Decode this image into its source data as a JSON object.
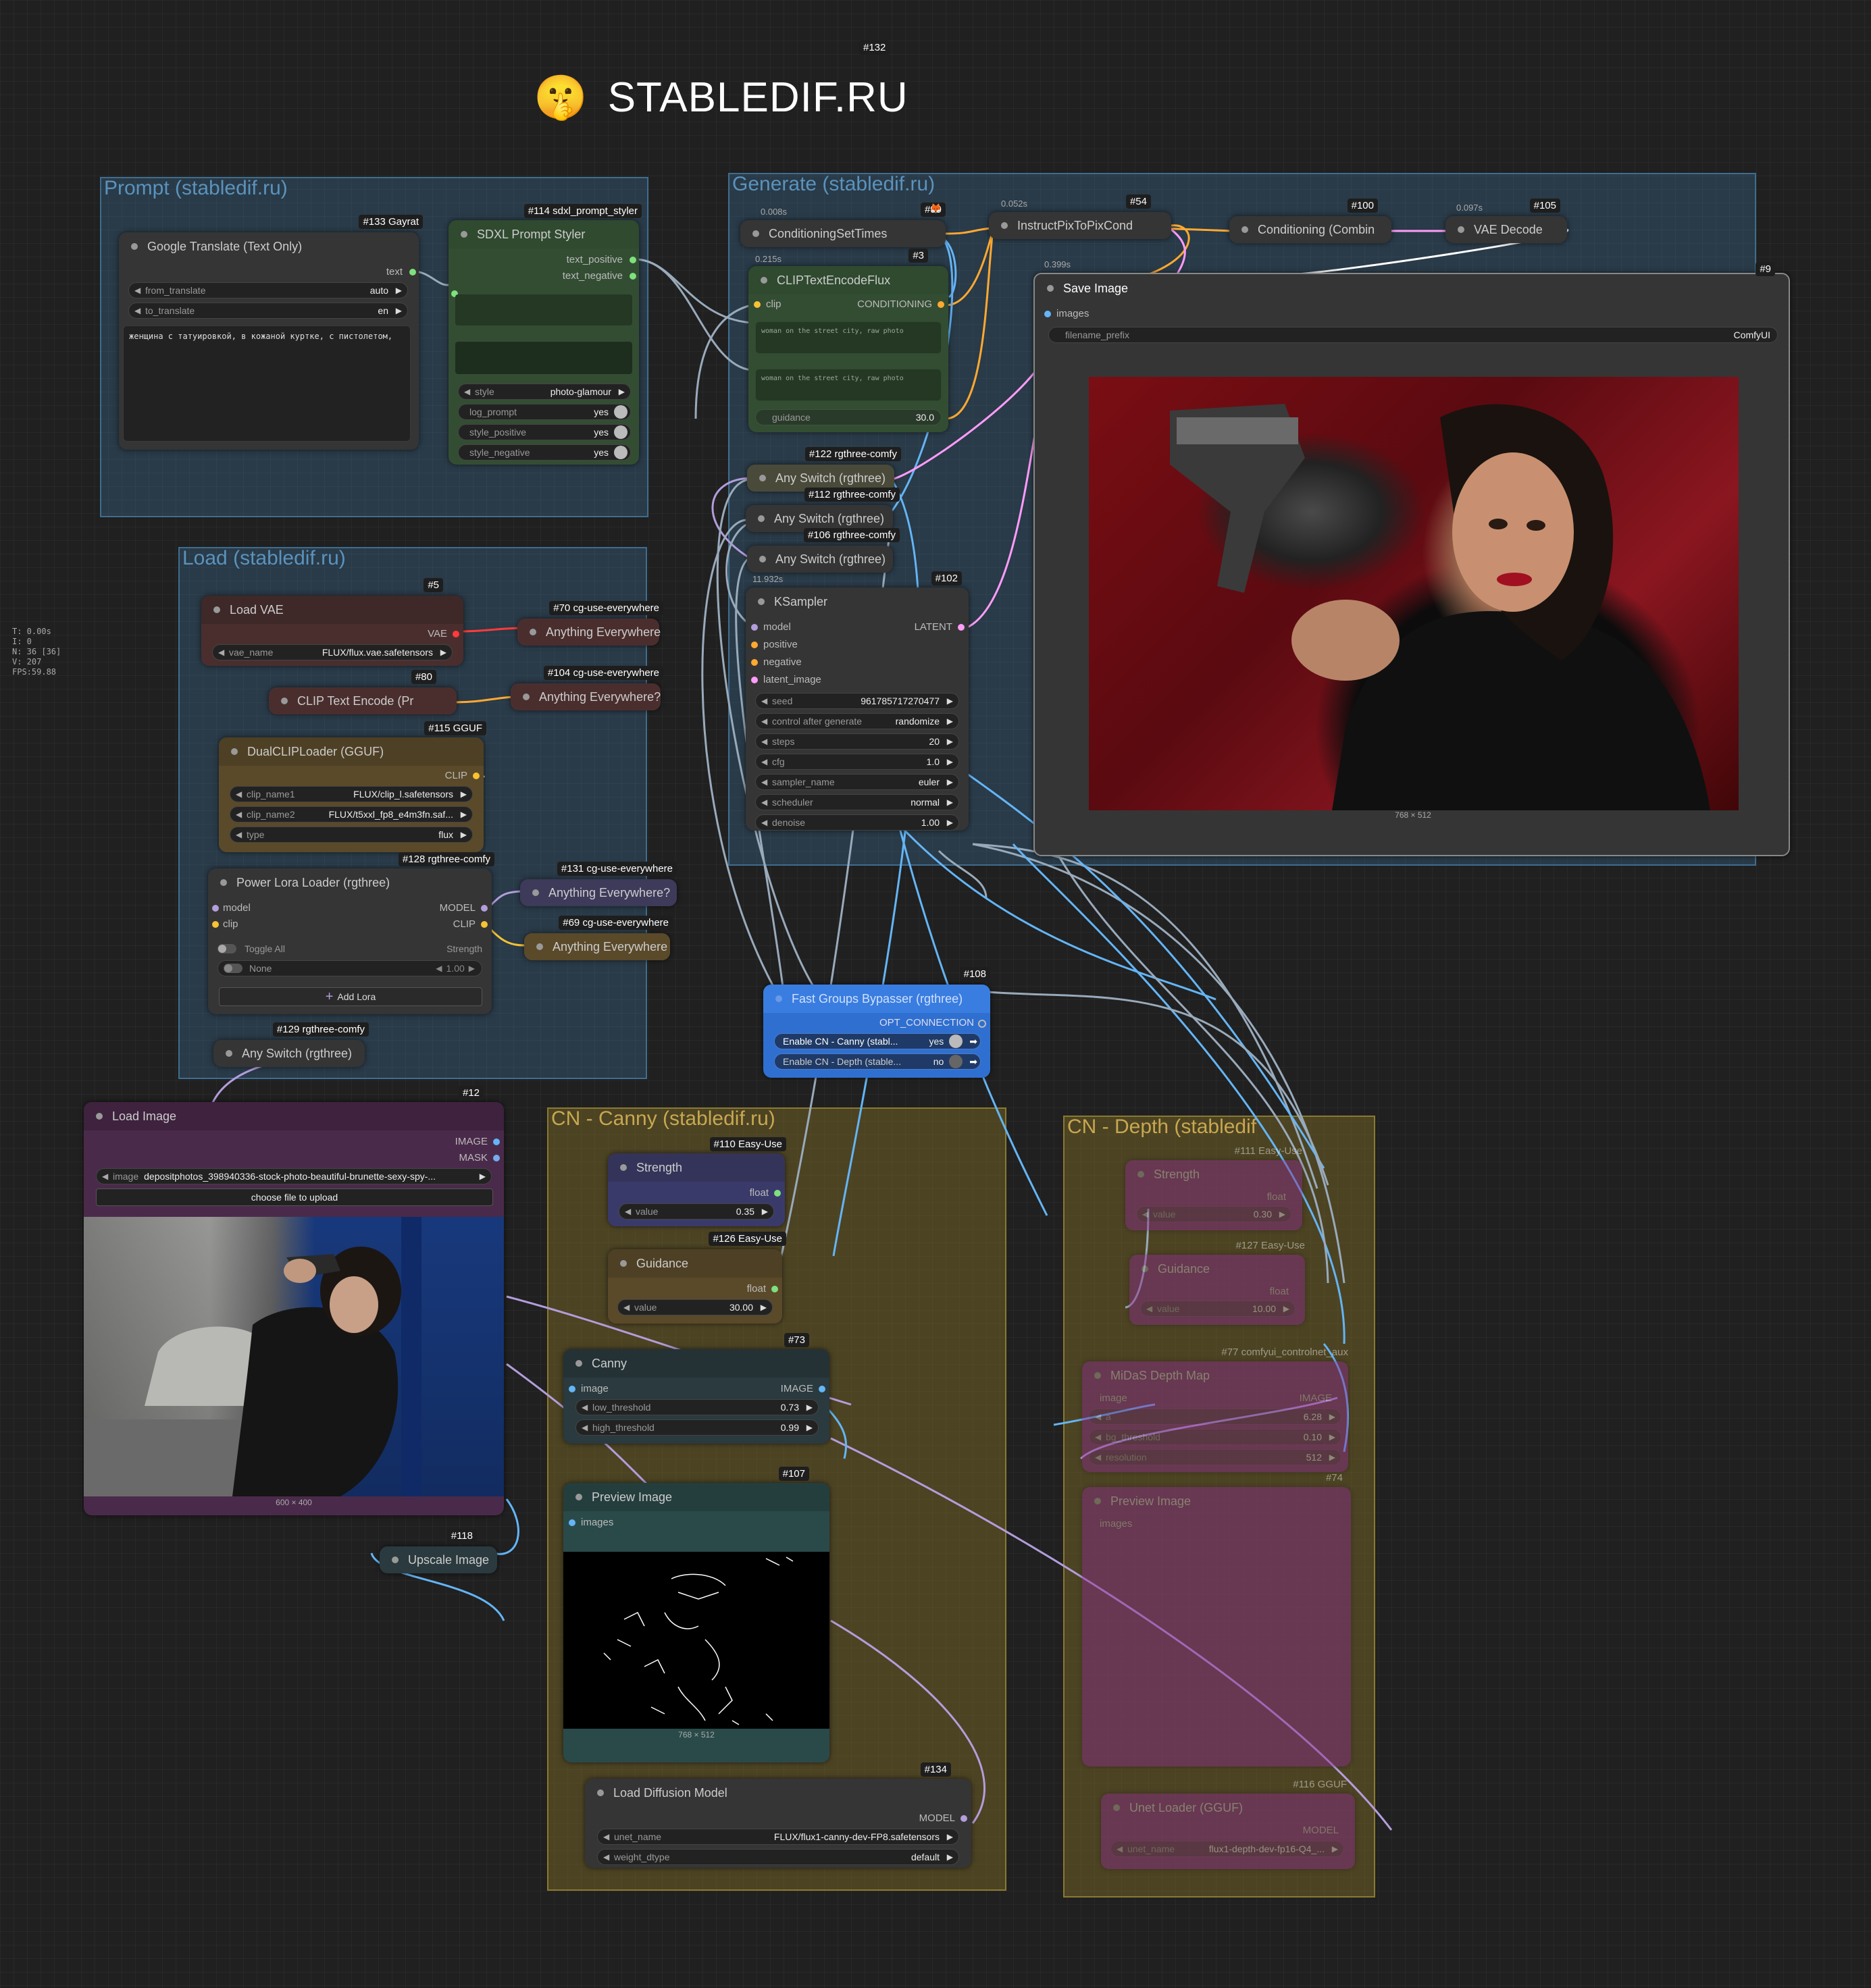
{
  "title_banner": {
    "emoji": "🤫",
    "text": "STABLEDIF.RU",
    "node_id": "#132"
  },
  "stats": {
    "t": "T: 0.00s",
    "i": "I: 0",
    "n": "N: 36 [36]",
    "v": "V: 207",
    "fps": "FPS:59.88"
  },
  "groups": {
    "prompt": "Prompt (stabledif.ru)",
    "load": "Load (stabledif.ru)",
    "generate": "Generate (stabledif.ru)",
    "canny": "CN - Canny (stabledif.ru)",
    "depth": "CN - Depth (stabledif"
  },
  "colors": {
    "prompt_group": "#3a5f7a",
    "load_group": "#3a5f7a",
    "canny_group": "#7a6a2e",
    "depth_group": "#7a6a2e",
    "accent_blue": "#2f6fd0",
    "clip_link": "#f7c234",
    "model_link": "#b39ddb",
    "image_link": "#64b5f6",
    "cond_link": "#ffa931",
    "latent_link": "#ff9cf9"
  },
  "nodes": {
    "google_translate": {
      "badge": "#133 Gayrat",
      "title": "Google Translate (Text Only)",
      "output": "text",
      "from_label": "from_translate",
      "from_value": "auto",
      "to_label": "to_translate",
      "to_value": "en",
      "text": "женщина с татуировкой, в кожаной куртке, с пистолетом,"
    },
    "sdxl_styler": {
      "badge": "#114 sdxl_prompt_styler",
      "title": "SDXL Prompt Styler",
      "out1": "text_positive",
      "out2": "text_negative",
      "style_label": "style",
      "style_value": "photo-glamour",
      "log_label": "log_prompt",
      "log_value": "yes",
      "sp_label": "style_positive",
      "sp_value": "yes",
      "sn_label": "style_negative",
      "sn_value": "yes"
    },
    "cond_set_times": {
      "badge": "#99",
      "time": "0.008s",
      "title": "ConditioningSetTimes"
    },
    "instruct_pix": {
      "badge": "#54",
      "time": "0.052s",
      "title": "InstructPixToPixCond"
    },
    "cond_combine": {
      "badge": "#100",
      "title": "Conditioning (Combin"
    },
    "vae_decode": {
      "badge": "#105",
      "time": "0.097s",
      "title": "VAE Decode"
    },
    "clip_encode_flux": {
      "badge": "#3",
      "time": "0.215s",
      "title": "CLIPTextEncodeFlux",
      "in": "clip",
      "out": "CONDITIONING",
      "text1": "woman on the street city, raw photo",
      "text2": "woman on the street city, raw photo",
      "guidance_label": "guidance",
      "guidance_value": "30.0"
    },
    "save_image": {
      "badge": "#9",
      "time": "0.399s",
      "title": "Save Image",
      "in": "images",
      "prefix_label": "filename_prefix",
      "prefix_value": "ComfyUI",
      "caption": "768 × 512"
    },
    "any_switch_122": {
      "badge": "#122 rgthree-comfy",
      "title": "Any Switch (rgthree)"
    },
    "any_switch_112": {
      "badge": "#112 rgthree-comfy",
      "title": "Any Switch (rgthree)"
    },
    "any_switch_106": {
      "badge": "#106 rgthree-comfy",
      "title": "Any Switch (rgthree)"
    },
    "ksampler": {
      "badge": "#102",
      "time": "11.932s",
      "title": "KSampler",
      "in_model": "model",
      "in_pos": "positive",
      "in_neg": "negative",
      "in_latent": "latent_image",
      "out": "LATENT",
      "widgets": [
        {
          "label": "seed",
          "value": "961785717270477"
        },
        {
          "label": "control after generate",
          "value": "randomize"
        },
        {
          "label": "steps",
          "value": "20"
        },
        {
          "label": "cfg",
          "value": "1.0"
        },
        {
          "label": "sampler_name",
          "value": "euler"
        },
        {
          "label": "scheduler",
          "value": "normal"
        },
        {
          "label": "denoise",
          "value": "1.00"
        }
      ]
    },
    "load_vae": {
      "badge": "#5",
      "title": "Load VAE",
      "out": "VAE",
      "w_label": "vae_name",
      "w_value": "FLUX/flux.vae.safetensors"
    },
    "ae_70": {
      "badge": "#70 cg-use-everywhere",
      "title": "Anything Everywhere"
    },
    "clip_text_encode": {
      "badge": "#80",
      "title": "CLIP Text Encode (Pr"
    },
    "ae_104": {
      "badge": "#104 cg-use-everywhere",
      "title": "Anything Everywhere?"
    },
    "dual_clip": {
      "badge": "#115 GGUF",
      "title": "DualCLIPLoader (GGUF)",
      "out": "CLIP",
      "c1_label": "clip_name1",
      "c1_value": "FLUX/clip_l.safetensors",
      "c2_label": "clip_name2",
      "c2_value": "FLUX/t5xxl_fp8_e4m3fn.saf...",
      "t_label": "type",
      "t_value": "flux"
    },
    "power_lora": {
      "badge": "#128 rgthree-comfy",
      "title": "Power Lora Loader (rgthree)",
      "in_model": "model",
      "in_clip": "clip",
      "out_model": "MODEL",
      "out_clip": "CLIP",
      "toggle_all": "Toggle All",
      "strength": "Strength",
      "lora_none": "None",
      "lora_value": "1.00",
      "add_lora": "Add Lora"
    },
    "ae_131": {
      "badge": "#131 cg-use-everywhere",
      "title": "Anything Everywhere?"
    },
    "ae_69": {
      "badge": "#69 cg-use-everywhere",
      "title": "Anything Everywhere"
    },
    "any_switch_129": {
      "badge": "#129 rgthree-comfy",
      "title": "Any Switch (rgthree)"
    },
    "fast_bypasser": {
      "badge": "#108",
      "title": "Fast Groups Bypasser (rgthree)",
      "out": "OPT_CONNECTION",
      "t1_label": "Enable CN - Canny (stabl...",
      "t1_value": "yes",
      "t2_label": "Enable CN - Depth (stable...",
      "t2_value": "no"
    },
    "load_image": {
      "badge": "#12",
      "title": "Load Image",
      "out1": "IMAGE",
      "out2": "MASK",
      "img_label": "image",
      "img_value": "depositphotos_398940336-stock-photo-beautiful-brunette-sexy-spy-...",
      "upload": "choose file to upload",
      "caption": "600 × 400"
    },
    "upscale_image": {
      "badge": "#118",
      "title": "Upscale Image"
    },
    "strength_110": {
      "badge": "#110 Easy-Use",
      "title": "Strength",
      "out": "float",
      "w_label": "value",
      "w_value": "0.35"
    },
    "guidance_126": {
      "badge": "#126 Easy-Use",
      "title": "Guidance",
      "out": "float",
      "w_label": "value",
      "w_value": "30.00"
    },
    "canny": {
      "badge": "#73",
      "title": "Canny",
      "in": "image",
      "out": "IMAGE",
      "lo_label": "low_threshold",
      "lo_value": "0.73",
      "hi_label": "high_threshold",
      "hi_value": "0.99"
    },
    "preview_107": {
      "badge": "#107",
      "title": "Preview Image",
      "in": "images",
      "caption": "768 × 512"
    },
    "load_diffusion": {
      "badge": "#134",
      "title": "Load Diffusion Model",
      "out": "MODEL",
      "u_label": "unet_name",
      "u_value": "FLUX/flux1-canny-dev-FP8.safetensors",
      "w_label": "weight_dtype",
      "w_value": "default"
    },
    "strength_111": {
      "badge": "#111 Easy-Use",
      "title": "Strength",
      "out": "float",
      "w_label": "value",
      "w_value": "0.30"
    },
    "guidance_127": {
      "badge": "#127 Easy-Use",
      "title": "Guidance",
      "out": "float",
      "w_label": "value",
      "w_value": "10.00"
    },
    "midas": {
      "badge": "#77 comfyui_controlnet_aux",
      "title": "MiDaS Depth Map",
      "in": "image",
      "out": "IMAGE",
      "a_label": "a",
      "a_value": "6.28",
      "bg_label": "bg_threshold",
      "bg_value": "0.10",
      "res_label": "resolution",
      "res_value": "512"
    },
    "preview_74": {
      "badge": "#74",
      "title": "Preview Image",
      "in": "images"
    },
    "unet_gguf": {
      "badge": "#116 GGUF",
      "title": "Unet Loader (GGUF)",
      "out": "MODEL",
      "u_label": "unet_name",
      "u_value": "flux1-depth-dev-fp16-Q4_..."
    }
  }
}
